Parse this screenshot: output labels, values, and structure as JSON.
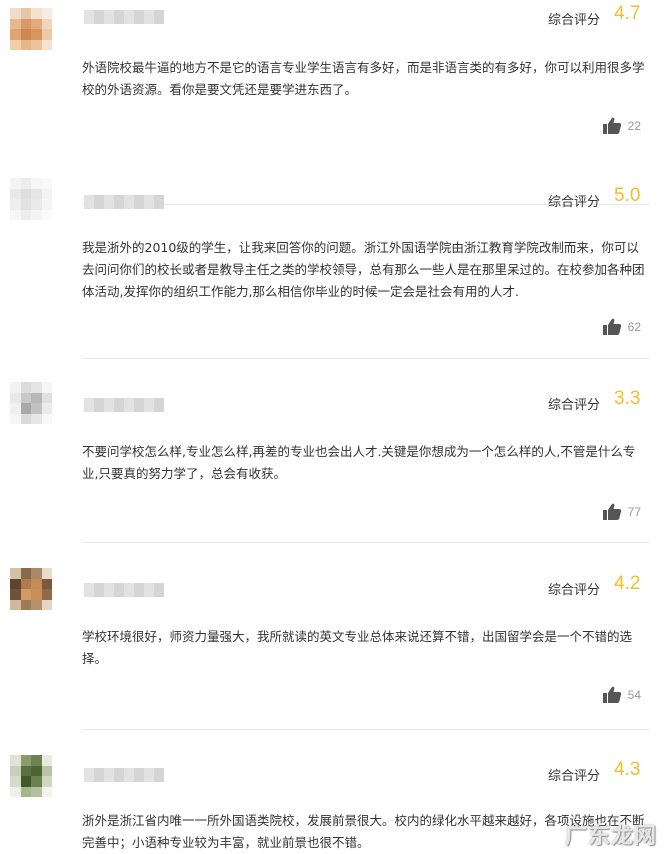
{
  "reviews": [
    {
      "rating_label": "综合评分",
      "score": "4.7",
      "text": "外语院校最牛逼的地方不是它的语言专业学生语言有多好，而是非语言类的有多好，你可以利用很多学校的外语资源。看你是要文凭还是要学进东西了。",
      "likes": "22"
    },
    {
      "rating_label": "综合评分",
      "score": "5.0",
      "text": "我是浙外的2010级的学生，让我来回答你的问题。浙江外国语学院由浙江教育学院改制而来，你可以去问问你们的校长或者是教导主任之类的学校领导，总有那么一些人是在那里呆过的。在校参加各种团体活动,发挥你的组织工作能力,那么相信你毕业的时候一定会是社会有用的人才.",
      "likes": "62"
    },
    {
      "rating_label": "综合评分",
      "score": "3.3",
      "text": "不要问学校怎么样,专业怎么样,再差的专业也会出人才.关键是你想成为一个怎么样的人,不管是什么专业,只要真的努力学了，总会有收获。",
      "likes": "77"
    },
    {
      "rating_label": "综合评分",
      "score": "4.2",
      "text": "学校环境很好，师资力量强大，我所就读的英文专业总体来说还算不错，出国留学会是一个不错的选择。",
      "likes": "54"
    },
    {
      "rating_label": "综合评分",
      "score": "4.3",
      "text": "浙外是浙江省内唯一一所外国语类院校，发展前景很大。校内的绿化水平越来越好，各项设施也在不断完善中；小语种专业较为丰富，就业前景也很不错。",
      "likes": ""
    }
  ],
  "watermark": "广东龙网",
  "colors": {
    "score": "#f3be2c",
    "divider": "#e8e8e8",
    "likes": "#999999",
    "thumb": "#555555"
  },
  "icons": {
    "like": "thumbs-up-icon"
  }
}
